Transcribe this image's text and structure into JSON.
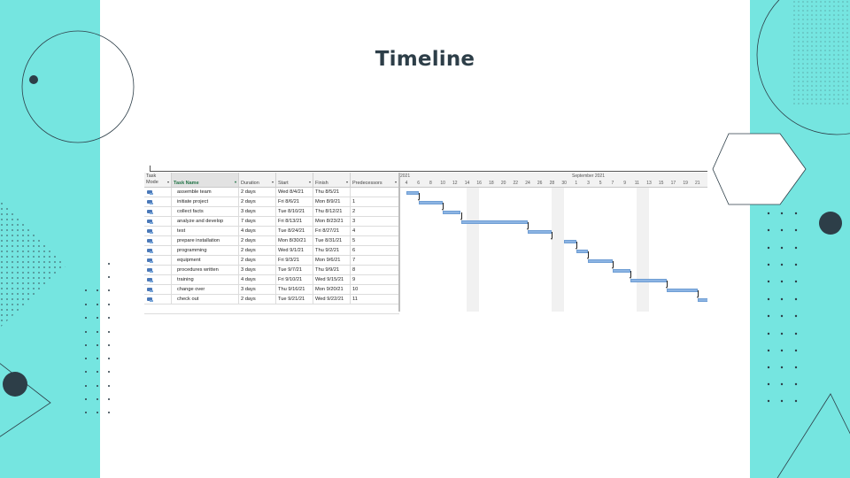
{
  "slide": {
    "title": "Timeline"
  },
  "colors": {
    "accent_panel": "#75e5e0",
    "title": "#2d3e48",
    "bar": "#8cb4e3",
    "task_name_header": "#217346"
  },
  "gantt": {
    "columns": {
      "mode": "Task Mode",
      "name": "Task Name",
      "duration": "Duration",
      "start": "Start",
      "finish": "Finish",
      "predecessors": "Predecessors"
    },
    "timescale": {
      "month_labels": [
        "2021",
        "September 2021"
      ],
      "days": [
        "4",
        "6",
        "8",
        "10",
        "12",
        "14",
        "16",
        "18",
        "20",
        "22",
        "24",
        "26",
        "28",
        "30",
        "1",
        "3",
        "5",
        "7",
        "9",
        "11",
        "13",
        "15",
        "17",
        "19",
        "21"
      ],
      "weekend_shading": "every other week"
    },
    "tasks": [
      {
        "name": "assemble team",
        "duration": "2 days",
        "start": "Wed 8/4/21",
        "finish": "Thu 8/5/21",
        "predecessors": ""
      },
      {
        "name": "initiate project",
        "duration": "2 days",
        "start": "Fri 8/6/21",
        "finish": "Mon 8/9/21",
        "predecessors": "1"
      },
      {
        "name": "collect facts",
        "duration": "3 days",
        "start": "Tue 8/10/21",
        "finish": "Thu 8/12/21",
        "predecessors": "2"
      },
      {
        "name": "analyze and develop",
        "duration": "7 days",
        "start": "Fri 8/13/21",
        "finish": "Mon 8/23/21",
        "predecessors": "3"
      },
      {
        "name": "test",
        "duration": "4 days",
        "start": "Tue 8/24/21",
        "finish": "Fri 8/27/21",
        "predecessors": "4"
      },
      {
        "name": "prepare installation",
        "duration": "2 days",
        "start": "Mon 8/30/21",
        "finish": "Tue 8/31/21",
        "predecessors": "5"
      },
      {
        "name": "programming",
        "duration": "2 days",
        "start": "Wed 9/1/21",
        "finish": "Thu 9/2/21",
        "predecessors": "6"
      },
      {
        "name": "equipment",
        "duration": "2 days",
        "start": "Fri 9/3/21",
        "finish": "Mon 9/6/21",
        "predecessors": "7"
      },
      {
        "name": "procedures written",
        "duration": "3 days",
        "start": "Tue 9/7/21",
        "finish": "Thu 9/9/21",
        "predecessors": "8"
      },
      {
        "name": "training",
        "duration": "4 days",
        "start": "Fri 9/10/21",
        "finish": "Wed 9/15/21",
        "predecessors": "9"
      },
      {
        "name": "change over",
        "duration": "3 days",
        "start": "Thu 9/16/21",
        "finish": "Mon 9/20/21",
        "predecessors": "10"
      },
      {
        "name": "check out",
        "duration": "2 days",
        "start": "Tue 9/21/21",
        "finish": "Wed 9/22/21",
        "predecessors": "11"
      }
    ]
  }
}
